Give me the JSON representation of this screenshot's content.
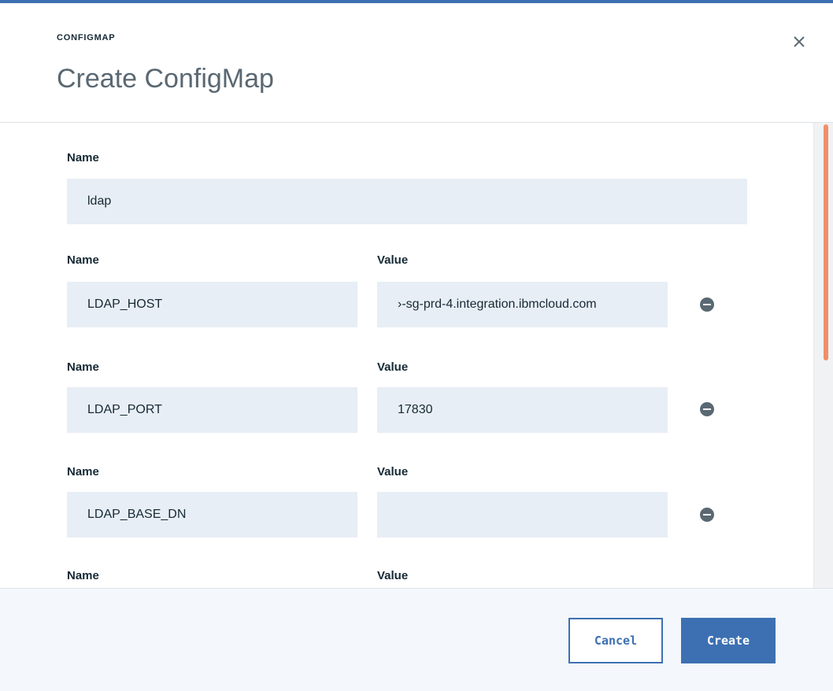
{
  "modal": {
    "eyebrow": "CONFIGMAP",
    "title": "Create ConfigMap",
    "close_icon": "close-icon"
  },
  "form": {
    "name_label": "Name",
    "name_value": "ldap",
    "pairs": [
      {
        "name_label": "Name",
        "value_label": "Value",
        "name": "LDAP_HOST",
        "value": "›-sg-prd-4.integration.ibmcloud.com"
      },
      {
        "name_label": "Name",
        "value_label": "Value",
        "name": "LDAP_PORT",
        "value": "17830"
      },
      {
        "name_label": "Name",
        "value_label": "Value",
        "name": "LDAP_BASE_DN",
        "value": ""
      },
      {
        "name_label": "Name",
        "value_label": "Value"
      }
    ],
    "remove_icon": "minus-circle-icon"
  },
  "footer": {
    "cancel_label": "Cancel",
    "create_label": "Create"
  },
  "colors": {
    "accent": "#3d70b2",
    "field_bg": "#e8eef5",
    "scroll_thumb": "#f08f6a"
  }
}
